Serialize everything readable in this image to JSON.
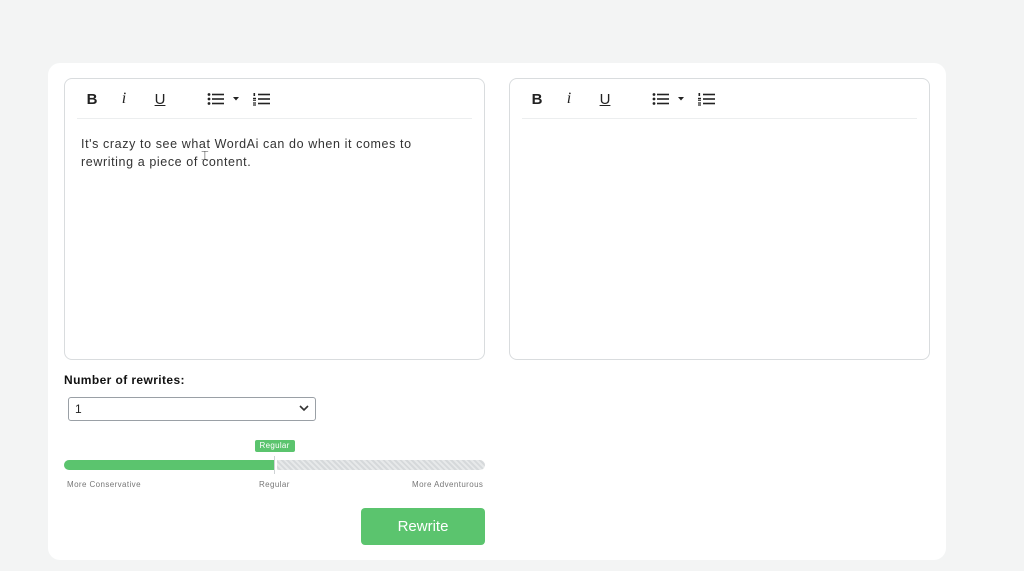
{
  "toolbar": {
    "bold_label": "B",
    "italic_label": "i",
    "underline_label": "U"
  },
  "input_editor": {
    "text": "It's crazy to see what WordAi can do when it comes to rewriting a piece of content."
  },
  "output_editor": {
    "text": ""
  },
  "rewrites": {
    "label": "Number of rewrites:",
    "selected": "1"
  },
  "creativity": {
    "value_label": "Regular",
    "value_fraction": 0.5,
    "left_label": "More Conservative",
    "middle_label": "Regular",
    "right_label": "More Adventurous"
  },
  "actions": {
    "rewrite_label": "Rewrite"
  },
  "colors": {
    "accent": "#5bc46e"
  }
}
